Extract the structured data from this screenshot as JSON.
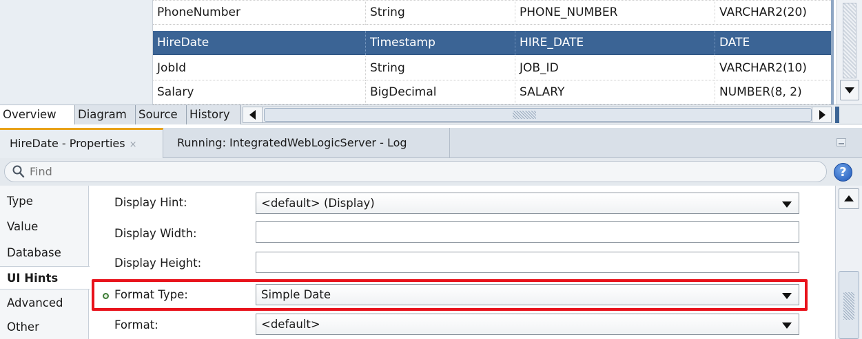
{
  "table": {
    "rows": [
      {
        "name": "PhoneNumber",
        "java_type": "String",
        "column": "PHONE_NUMBER",
        "sql_type": "VARCHAR2(20)",
        "selected": false
      },
      {
        "name": "HireDate",
        "java_type": "Timestamp",
        "column": "HIRE_DATE",
        "sql_type": "DATE",
        "selected": true
      },
      {
        "name": "JobId",
        "java_type": "String",
        "column": "JOB_ID",
        "sql_type": "VARCHAR2(10)",
        "selected": false
      },
      {
        "name": "Salary",
        "java_type": "BigDecimal",
        "column": "SALARY",
        "sql_type": "NUMBER(8, 2)",
        "selected": false
      }
    ]
  },
  "editor_tabs": {
    "overview": "Overview",
    "diagram": "Diagram",
    "source": "Source",
    "history": "History"
  },
  "panel_tabs": {
    "properties": "HireDate - Properties",
    "properties_close": "×",
    "log": "Running: IntegratedWebLogicServer - Log"
  },
  "search": {
    "placeholder": "Find",
    "help_symbol": "?"
  },
  "side_nav": {
    "type": "Type",
    "value": "Value",
    "database": "Database",
    "ui_hints": "UI Hints",
    "advanced": "Advanced",
    "other": "Other"
  },
  "properties": {
    "display_hint_label": "Display Hint:",
    "display_hint_value": "<default> (Display)",
    "display_width_label": "Display Width:",
    "display_width_value": "",
    "display_height_label": "Display Height:",
    "display_height_value": "",
    "format_type_label": "Format Type:",
    "format_type_value": "Simple Date",
    "format_label": "Format:",
    "format_value": "<default>"
  },
  "colors": {
    "selection": "#3b6495",
    "highlight": "#e8121b",
    "active_tab_accent": "#e8a21a"
  }
}
